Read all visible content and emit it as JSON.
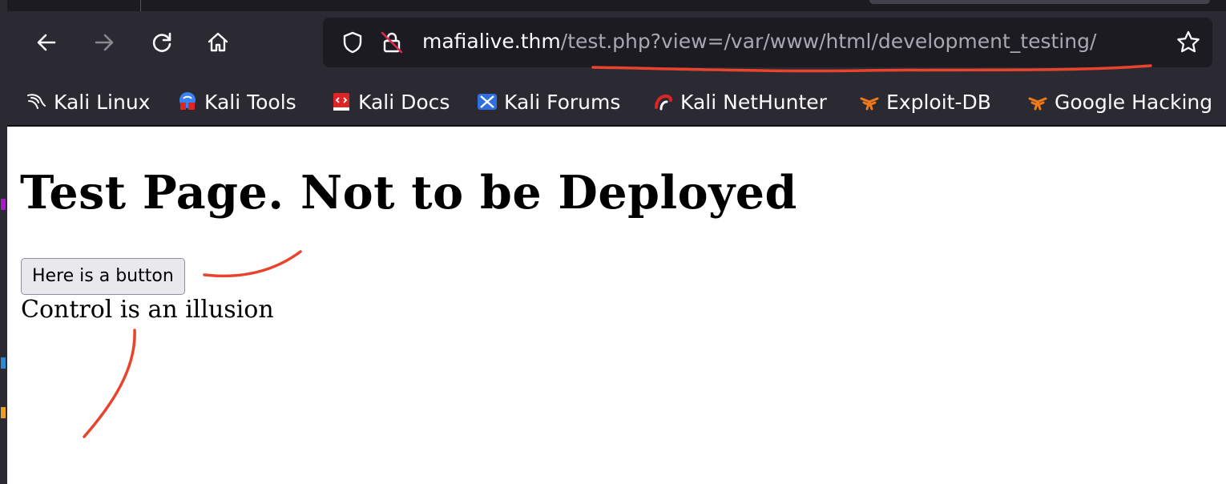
{
  "browser": {
    "url": {
      "host": "mafialive.thm",
      "path": "/test.php?view=/var/www/html/development_testing/"
    },
    "nav_icons": [
      "back-arrow-icon",
      "forward-arrow-icon",
      "reload-icon",
      "home-icon"
    ],
    "bookmarks": [
      {
        "label": "Kali Linux",
        "icon": "kali-dragon-icon"
      },
      {
        "label": "Kali Tools",
        "icon": "kali-tools-icon"
      },
      {
        "label": "Kali Docs",
        "icon": "kali-docs-icon"
      },
      {
        "label": "Kali Forums",
        "icon": "kali-forums-icon"
      },
      {
        "label": "Kali NetHunter",
        "icon": "kali-nethunter-icon"
      },
      {
        "label": "Exploit-DB",
        "icon": "exploit-db-icon"
      },
      {
        "label": "Google Hacking",
        "icon": "google-hacking-icon"
      }
    ]
  },
  "page": {
    "heading": "Test Page. Not to be Deployed",
    "button_label": "Here is a button",
    "text": "Control is an illusion"
  },
  "colors": {
    "toolbar_bg": "#2b2a33",
    "urlbar_bg": "#1c1b22",
    "annotation_red": "#e8432c"
  }
}
